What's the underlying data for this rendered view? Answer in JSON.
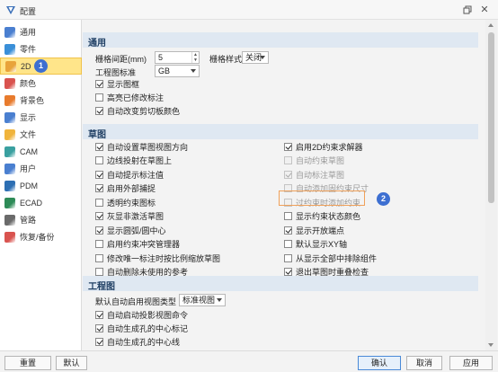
{
  "window": {
    "title": "配置"
  },
  "sidebar": {
    "items": [
      {
        "label": "通用",
        "icon": "general-settings-icon",
        "color": "#4a7fd0"
      },
      {
        "label": "零件",
        "icon": "part-icon",
        "color": "#3a8fd8"
      },
      {
        "label": "2D",
        "icon": "2d-drawing-icon",
        "color": "#e8a33a",
        "active": true
      },
      {
        "label": "颜色",
        "icon": "color-palette-icon",
        "color": "#d9534f"
      },
      {
        "label": "背景色",
        "icon": "background-color-icon",
        "color": "#e87b2d"
      },
      {
        "label": "显示",
        "icon": "display-icon",
        "color": "#4a7fd0"
      },
      {
        "label": "文件",
        "icon": "folder-icon",
        "color": "#f0b43c"
      },
      {
        "label": "CAM",
        "icon": "cam-icon",
        "color": "#3aa0a0"
      },
      {
        "label": "用户",
        "icon": "user-icon",
        "color": "#4a7fd0"
      },
      {
        "label": "PDM",
        "icon": "pdm-icon",
        "color": "#2d6fb3"
      },
      {
        "label": "ECAD",
        "icon": "ecad-icon",
        "color": "#2e8b57"
      },
      {
        "label": "管路",
        "icon": "pipe-icon",
        "color": "#6a6a6a"
      },
      {
        "label": "恢复/备份",
        "icon": "restore-backup-icon",
        "color": "#d9534f"
      }
    ],
    "badge1": "1"
  },
  "general": {
    "header": "通用",
    "grid_spacing_label": "栅格间距(mm)",
    "grid_spacing_value": "5",
    "grid_style_label": "栅格样式",
    "grid_style_value": "关闭",
    "standard_label": "工程图标准",
    "standard_value": "GB",
    "checkboxes": [
      {
        "label": "显示图框",
        "checked": true
      },
      {
        "label": "高亮已修改标注",
        "checked": false
      },
      {
        "label": "自动改变剪切板颜色",
        "checked": true
      }
    ]
  },
  "sketch": {
    "header": "草图",
    "left": [
      {
        "label": "自动设置草图视图方向",
        "checked": true
      },
      {
        "label": "边线投射在草图上",
        "checked": false
      },
      {
        "label": "自动提示标注值",
        "checked": true
      },
      {
        "label": "启用外部捕捉",
        "checked": true
      },
      {
        "label": "透明约束图标",
        "checked": false
      },
      {
        "label": "灰显非激活草图",
        "checked": true
      },
      {
        "label": "显示圆弧/圆中心",
        "checked": true
      },
      {
        "label": "启用约束冲突管理器",
        "checked": false
      },
      {
        "label": "修改唯一标注时按比例缩放草图",
        "checked": false
      },
      {
        "label": "自动删除未使用的参考",
        "checked": false
      }
    ],
    "right": [
      {
        "label": "启用2D约束求解器",
        "checked": true,
        "disabled": false
      },
      {
        "label": "自动约束草图",
        "checked": false,
        "disabled": true
      },
      {
        "label": "自动标注草图",
        "checked": true,
        "disabled": true
      },
      {
        "label": "自动添加固约束尺寸",
        "checked": false,
        "disabled": true
      },
      {
        "label": "过约束时添加约束",
        "checked": false,
        "disabled": true
      },
      {
        "label": "显示约束状态颜色",
        "checked": false,
        "disabled": false
      },
      {
        "label": "显示开放端点",
        "checked": true,
        "disabled": false
      },
      {
        "label": "默认显示XY轴",
        "checked": false,
        "disabled": false
      },
      {
        "label": "从显示全部中排除组件",
        "checked": false,
        "disabled": false
      },
      {
        "label": "退出草图时重叠检查",
        "checked": true,
        "disabled": false
      }
    ],
    "badge2": "2"
  },
  "drawing": {
    "header": "工程图",
    "view_type_label": "默认自动启用视图类型",
    "view_type_value": "标准视图",
    "checkboxes": [
      {
        "label": "自动启动投影视图命令",
        "checked": true
      },
      {
        "label": "自动生成孔的中心标记",
        "checked": true
      },
      {
        "label": "自动生成孔的中心线",
        "checked": true
      }
    ]
  },
  "footer": {
    "reset": "重置",
    "default": "默认",
    "ok": "确认",
    "cancel": "取消",
    "apply": "应用"
  },
  "colors": {
    "active_item": "#ffe58a",
    "section_header": "#dfe8f2",
    "badge": "#3d6fd1",
    "highlight": "#f0a15a"
  }
}
